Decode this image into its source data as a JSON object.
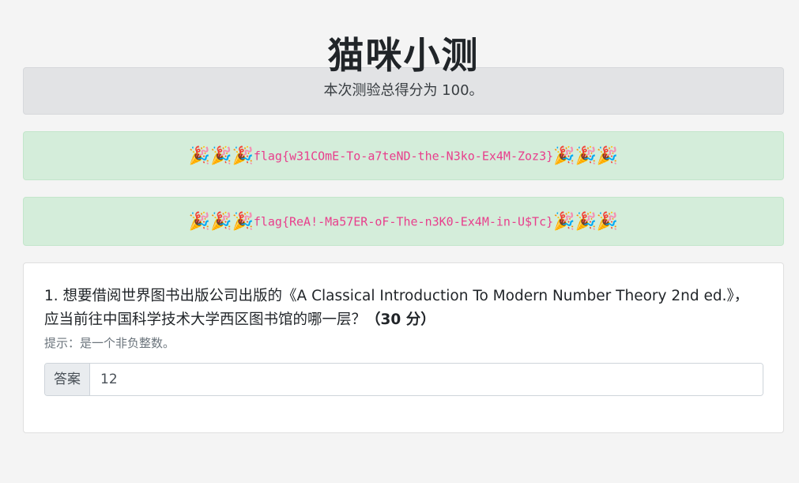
{
  "header": {
    "title": "猫咪小测"
  },
  "score": {
    "text": "本次测验总得分为 100。"
  },
  "flags": [
    {
      "emoji_left": "🎉🎉🎉",
      "flag": "flag{w31COmE-To-a7teND-the-N3ko-Ex4M-Zoz3}",
      "emoji_right": "🎉🎉🎉"
    },
    {
      "emoji_left": "🎉🎉🎉",
      "flag": "flag{ReA!-Ma57ER-oF-The-n3K0-Ex4M-in-U$Tc}",
      "emoji_right": "🎉🎉🎉"
    }
  ],
  "question": {
    "text": "1. 想要借阅世界图书出版公司出版的《A Classical Introduction To Modern Number Theory 2nd ed.》，应当前往中国科学技术大学西区图书馆的哪一层？",
    "points": "（30 分）",
    "hint": "提示：是一个非负整数。",
    "answer_label": "答案",
    "answer_value": "12"
  },
  "colors": {
    "background": "#f4f4f4",
    "score_bg": "#e2e3e5",
    "flag_bg": "#d4edda",
    "flag_text": "#e83e8c"
  }
}
